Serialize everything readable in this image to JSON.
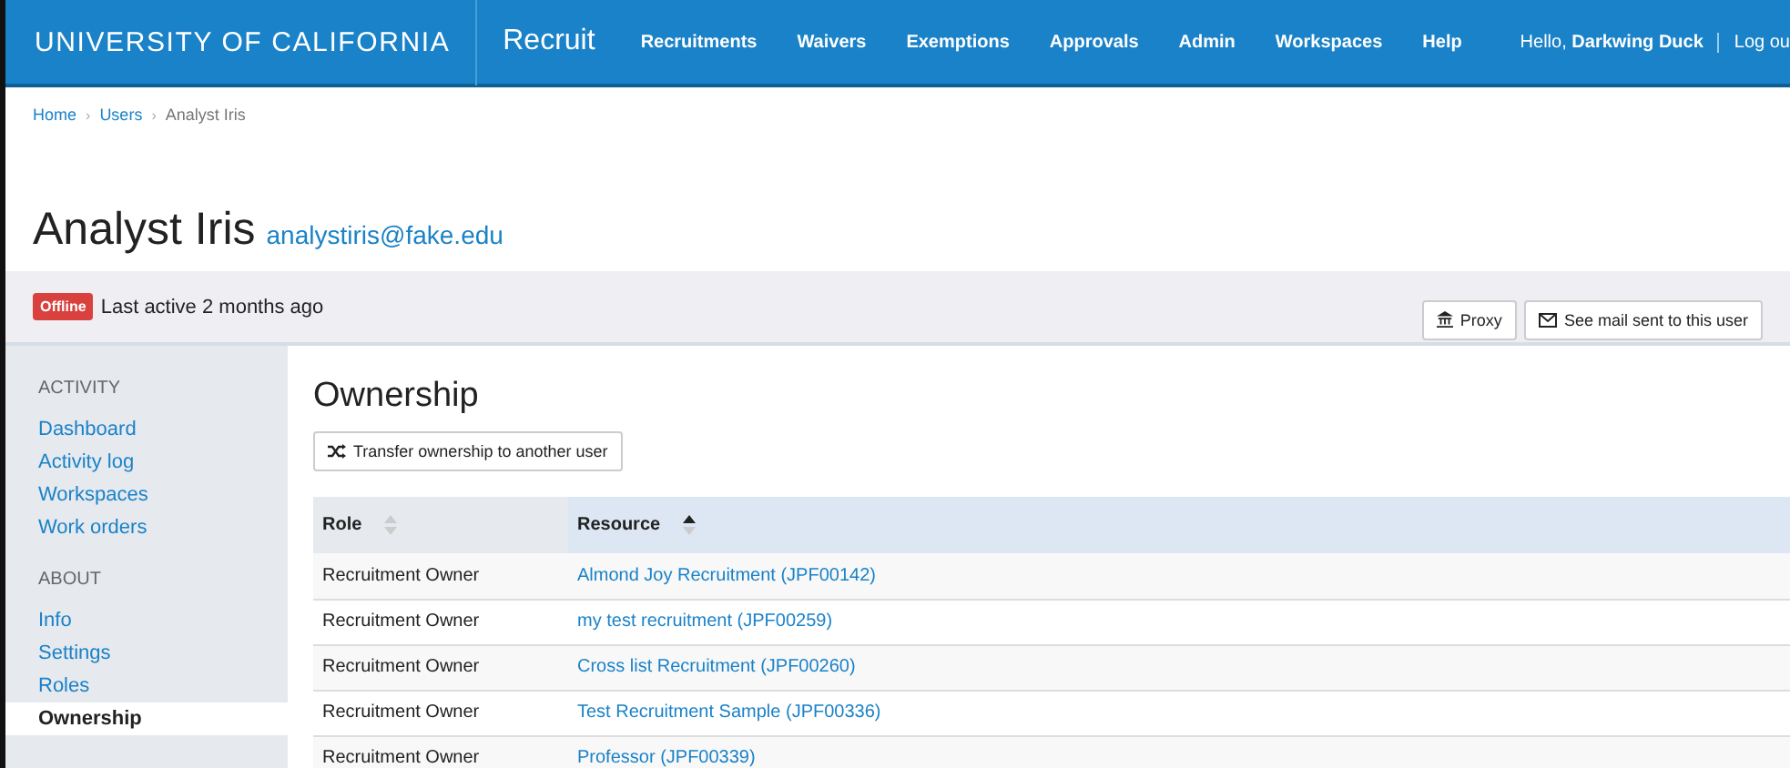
{
  "header": {
    "brand": "UNIVERSITY OF CALIFORNIA",
    "app": "Recruit",
    "nav": [
      "Recruitments",
      "Waivers",
      "Exemptions",
      "Approvals",
      "Admin",
      "Workspaces",
      "Help"
    ],
    "greeting": "Hello,",
    "user": "Darkwing Duck",
    "logout": "Log ou"
  },
  "breadcrumb_separator": "›",
  "breadcrumb": [
    {
      "label": "Home",
      "link": true
    },
    {
      "label": "Users",
      "link": true
    },
    {
      "label": "Analyst Iris",
      "link": false
    }
  ],
  "profile": {
    "name": "Analyst Iris",
    "email": "analystiris@fake.edu",
    "status": "Offline",
    "last_active": "Last active 2 months ago"
  },
  "actions": [
    {
      "label": "Proxy",
      "kind": "proxy"
    },
    {
      "label": "See mail sent to this user",
      "kind": "mail"
    }
  ],
  "sidebar": [
    {
      "heading": "ACTIVITY",
      "items": [
        {
          "label": "Dashboard",
          "selected": false
        },
        {
          "label": "Activity log",
          "selected": false
        },
        {
          "label": "Workspaces",
          "selected": false
        },
        {
          "label": "Work orders",
          "selected": false
        }
      ]
    },
    {
      "heading": "ABOUT",
      "items": [
        {
          "label": "Info",
          "selected": false
        },
        {
          "label": "Settings",
          "selected": false
        },
        {
          "label": "Roles",
          "selected": false
        },
        {
          "label": "Ownership",
          "selected": true
        }
      ]
    }
  ],
  "main": {
    "title": "Ownership",
    "transfer_button": "Transfer ownership to another user"
  },
  "table": {
    "columns": [
      {
        "label": "Role",
        "sorted": false
      },
      {
        "label": "Resource",
        "sorted": true
      }
    ],
    "rows": [
      [
        "Recruitment Owner",
        "Almond Joy Recruitment (JPF00142)"
      ],
      [
        "Recruitment Owner",
        "my test recruitment (JPF00259)"
      ],
      [
        "Recruitment Owner",
        "Cross list Recruitment (JPF00260)"
      ],
      [
        "Recruitment Owner",
        "Test Recruitment Sample (JPF00336)"
      ],
      [
        "Recruitment Owner",
        "Professor (JPF00339)"
      ]
    ]
  }
}
